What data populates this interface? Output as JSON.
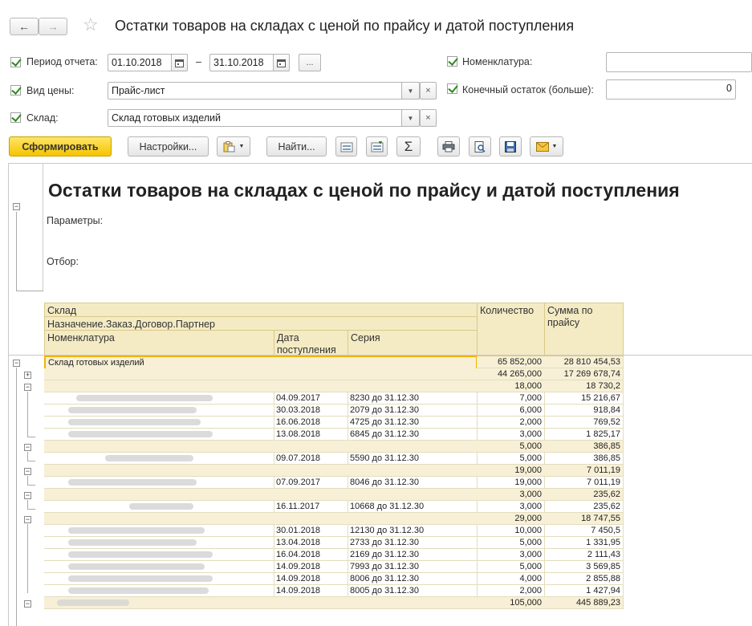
{
  "window": {
    "title": "Остатки товаров на складах с ценой по прайсу и датой поступления"
  },
  "nav": {
    "back": "←",
    "forward": "→",
    "favorite": "☆"
  },
  "params": {
    "period_label": "Период отчета:",
    "period_from": "01.10.2018",
    "period_sep": "–",
    "period_to": "31.10.2018",
    "period_more": "...",
    "price_label": "Вид цены:",
    "price_value": "Прайс-лист",
    "warehouse_label": "Склад:",
    "warehouse_value": "Склад готовых изделий",
    "nomenclature_label": "Номенклатура:",
    "nomenclature_value": "",
    "end_balance_label": "Конечный остаток (больше):",
    "end_balance_value": "0"
  },
  "toolbar": {
    "generate": "Сформировать",
    "settings": "Настройки...",
    "find": "Найти..."
  },
  "report": {
    "title": "Остатки товаров на складах с ценой по прайсу и датой поступления",
    "params_label": "Параметры:",
    "filter_label": "Отбор:",
    "headers": {
      "warehouse": "Склад",
      "purpose": "Назначение.Заказ.Договор.Партнер",
      "nomenclature": "Номенклатура",
      "date": "Дата поступления",
      "series": "Серия",
      "qty": "Количество",
      "sum": "Сумма по прайсу"
    },
    "rows": [
      {
        "name": "Склад готовых изделий",
        "date": "",
        "series": "",
        "qty": "65 852,000",
        "sum": "28 810 454,53"
      },
      {
        "name": "",
        "date": "",
        "series": "",
        "qty": "44 265,000",
        "sum": "17 269 678,74"
      },
      {
        "name": "",
        "date": "",
        "series": "",
        "qty": "18,000",
        "sum": "18 730,2"
      },
      {
        "name": "",
        "date": "04.09.2017",
        "series": "8230 до 31.12.30",
        "qty": "7,000",
        "sum": "15 216,67"
      },
      {
        "name": "",
        "date": "30.03.2018",
        "series": "2079 до 31.12.30",
        "qty": "6,000",
        "sum": "918,84"
      },
      {
        "name": "",
        "date": "16.06.2018",
        "series": "4725 до 31.12.30",
        "qty": "2,000",
        "sum": "769,52"
      },
      {
        "name": "",
        "date": "13.08.2018",
        "series": "6845 до 31.12.30",
        "qty": "3,000",
        "sum": "1 825,17"
      },
      {
        "name": "",
        "date": "",
        "series": "",
        "qty": "5,000",
        "sum": "386,85"
      },
      {
        "name": "",
        "date": "09.07.2018",
        "series": "5590 до 31.12.30",
        "qty": "5,000",
        "sum": "386,85"
      },
      {
        "name": "",
        "date": "",
        "series": "",
        "qty": "19,000",
        "sum": "7 011,19"
      },
      {
        "name": "",
        "date": "07.09.2017",
        "series": "8046 до 31.12.30",
        "qty": "19,000",
        "sum": "7 011,19"
      },
      {
        "name": "",
        "date": "",
        "series": "",
        "qty": "3,000",
        "sum": "235,62"
      },
      {
        "name": "",
        "date": "16.11.2017",
        "series": "10668 до 31.12.30",
        "qty": "3,000",
        "sum": "235,62"
      },
      {
        "name": "",
        "date": "",
        "series": "",
        "qty": "29,000",
        "sum": "18 747,55"
      },
      {
        "name": "",
        "date": "30.01.2018",
        "series": "12130 до 31.12.30",
        "qty": "10,000",
        "sum": "7 450,5"
      },
      {
        "name": "",
        "date": "13.04.2018",
        "series": "2733 до 31.12.30",
        "qty": "5,000",
        "sum": "1 331,95"
      },
      {
        "name": "",
        "date": "16.04.2018",
        "series": "2169 до 31.12.30",
        "qty": "3,000",
        "sum": "2 111,43"
      },
      {
        "name": "",
        "date": "14.09.2018",
        "series": "7993 до 31.12.30",
        "qty": "5,000",
        "sum": "3 569,85"
      },
      {
        "name": "",
        "date": "14.09.2018",
        "series": "8006 до 31.12.30",
        "qty": "4,000",
        "sum": "2 855,88"
      },
      {
        "name": "",
        "date": "14.09.2018",
        "series": "8005 до 31.12.30",
        "qty": "2,000",
        "sum": "1 427,94"
      },
      {
        "name": "",
        "date": "",
        "series": "",
        "qty": "105,000",
        "sum": "445 889,23"
      }
    ]
  },
  "colors": {
    "accent": "#f5c400",
    "group_bg": "#f4ebc4",
    "check": "#2e8b1e"
  }
}
